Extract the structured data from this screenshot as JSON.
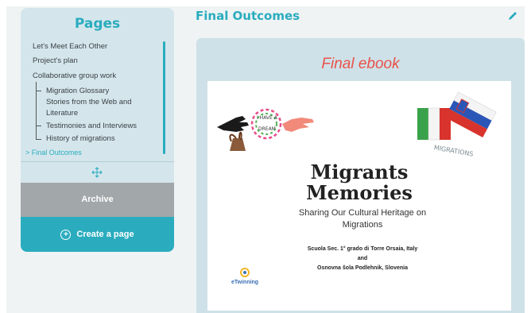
{
  "sidebar": {
    "title": "Pages",
    "items": [
      {
        "label": "Let's Meet Each Other"
      },
      {
        "label": "Project's plan"
      },
      {
        "label": "Collaborative group work"
      },
      {
        "label": "Migration Glossary"
      },
      {
        "label": "Stories from the Web and"
      },
      {
        "label": "Literature"
      },
      {
        "label": "Testimonies and Interviews"
      },
      {
        "label": "History of migrations"
      },
      {
        "label": "> Final Outcomes"
      }
    ],
    "archive_label": "Archive",
    "create_label": "Create a page"
  },
  "main": {
    "title": "Final Outcomes",
    "panel_heading": "Final ebook"
  },
  "cover": {
    "drawing_text_1": "I HAVE A",
    "drawing_text_2": "DREAM",
    "migrations_text": "MIGRATIONS",
    "title_line1": "Migrants",
    "title_line2": "Memories",
    "subtitle_line1": "Sharing Our Cultural Heritage on",
    "subtitle_line2": "Migrations",
    "school1": "Scuola Sec. 1° grado di Torre  Orsaia, Italy",
    "and": "and",
    "school2": "Osnovna šola Podlehnik, Slovenia",
    "etwinning": "eTwinning"
  },
  "colors": {
    "accent": "#2aacbe",
    "heading_red": "#e8524a",
    "archive_gray": "#a2a8aa"
  }
}
